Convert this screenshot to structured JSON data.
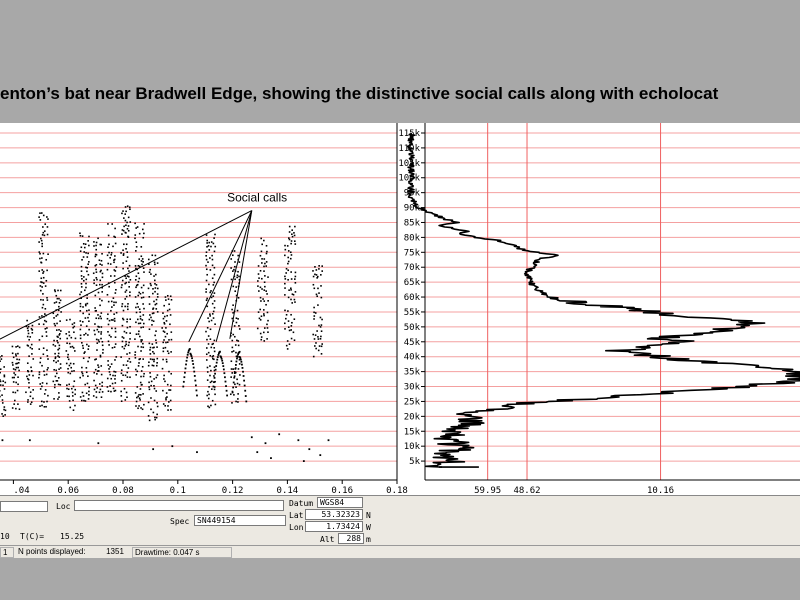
{
  "slide": {
    "title": "enton’s bat near Bradwell Edge, showing the distinctive social calls along with echolocat"
  },
  "annotation": {
    "label": "Social calls"
  },
  "info": {
    "loc_label": "Loc",
    "spec_label": "Spec",
    "spec_value": "SN449154",
    "temp_prefix": "10",
    "temp_label": "T(C)=",
    "temp_value": "15.25",
    "datum_label": "Datum",
    "datum_value": "WGS84",
    "lat_label": "Lat",
    "lat_value": "53.32323",
    "lat_dir": "N",
    "lon_label": "Lon",
    "lon_value": "1.73424",
    "lon_dir": "W",
    "alt_label": "Alt",
    "alt_value": "288",
    "alt_unit": "m"
  },
  "status": {
    "cell1": "1",
    "npoints_label": "N points displayed:",
    "npoints_value": "1351",
    "drawtime": "Drawtime: 0.047 s"
  },
  "chart_data": [
    {
      "type": "scatter",
      "title": "",
      "xlabel": "",
      "ylabel": "",
      "xlim": [
        0.03,
        0.18
      ],
      "ylim": [
        0,
        115
      ],
      "x_tick_labels": [
        ".04",
        "0.06",
        "0.08",
        "0.1",
        "0.12",
        "0.14",
        "0.16",
        "0.18"
      ],
      "x_ticks": [
        0.04,
        0.06,
        0.08,
        0.1,
        0.12,
        0.14,
        0.16,
        0.18
      ],
      "grid": true,
      "call_groups": [
        {
          "t": 0.031,
          "w": 0.002,
          "low": 22,
          "high": 48
        },
        {
          "t": 0.036,
          "w": 0.002,
          "low": 20,
          "high": 40
        },
        {
          "t": 0.041,
          "w": 0.002,
          "low": 22,
          "high": 44
        },
        {
          "t": 0.046,
          "w": 0.002,
          "low": 24,
          "high": 52
        },
        {
          "t": 0.051,
          "w": 0.0025,
          "low": 23,
          "high": 88
        },
        {
          "t": 0.056,
          "w": 0.002,
          "low": 25,
          "high": 62
        },
        {
          "t": 0.061,
          "w": 0.0025,
          "low": 22,
          "high": 52
        },
        {
          "t": 0.066,
          "w": 0.0025,
          "low": 25,
          "high": 82
        },
        {
          "t": 0.071,
          "w": 0.0025,
          "low": 26,
          "high": 80
        },
        {
          "t": 0.076,
          "w": 0.0025,
          "low": 28,
          "high": 85
        },
        {
          "t": 0.081,
          "w": 0.0025,
          "low": 25,
          "high": 90
        },
        {
          "t": 0.086,
          "w": 0.0025,
          "low": 22,
          "high": 85
        },
        {
          "t": 0.091,
          "w": 0.0025,
          "low": 18,
          "high": 75
        },
        {
          "t": 0.096,
          "w": 0.0025,
          "low": 22,
          "high": 60
        },
        {
          "t": 0.112,
          "w": 0.0025,
          "low": 23,
          "high": 82
        },
        {
          "t": 0.121,
          "w": 0.0025,
          "low": 24,
          "high": 75
        },
        {
          "t": 0.131,
          "w": 0.003,
          "low": 45,
          "high": 80
        },
        {
          "t": 0.141,
          "w": 0.003,
          "low": 42,
          "high": 84
        },
        {
          "t": 0.151,
          "w": 0.0025,
          "low": 40,
          "high": 70
        }
      ],
      "social_calls": [
        {
          "t": 0.104,
          "low": 30,
          "high": 44
        },
        {
          "t": 0.115,
          "low": 30,
          "high": 43
        },
        {
          "t": 0.122,
          "low": 28,
          "high": 43
        }
      ],
      "low_scatter": [
        {
          "t": 0.046,
          "f": 12
        },
        {
          "t": 0.071,
          "f": 11
        },
        {
          "t": 0.091,
          "f": 9
        },
        {
          "t": 0.098,
          "f": 10
        },
        {
          "t": 0.107,
          "f": 8
        },
        {
          "t": 0.127,
          "f": 13
        },
        {
          "t": 0.129,
          "f": 8
        },
        {
          "t": 0.132,
          "f": 11
        },
        {
          "t": 0.134,
          "f": 6
        },
        {
          "t": 0.137,
          "f": 14
        },
        {
          "t": 0.144,
          "f": 12
        },
        {
          "t": 0.146,
          "f": 5
        },
        {
          "t": 0.148,
          "f": 9
        },
        {
          "t": 0.152,
          "f": 7
        },
        {
          "t": 0.155,
          "f": 12
        },
        {
          "t": 0.031,
          "f": 7
        },
        {
          "t": 0.036,
          "f": 12
        }
      ]
    },
    {
      "type": "line",
      "title": "",
      "xlabel": "",
      "ylabel": "",
      "ylim": [
        0,
        115
      ],
      "y_tick_labels": [
        "5k",
        "10k",
        "15k",
        "20k",
        "25k",
        "30k",
        "35k",
        "40k",
        "45k",
        "50k",
        "55k",
        "60k",
        "65k",
        "70k",
        "75k",
        "80k",
        "85k",
        "90k",
        "95k",
        "100k",
        "105k",
        "110k",
        "115k"
      ],
      "y_ticks": [
        5,
        10,
        15,
        20,
        25,
        30,
        35,
        40,
        45,
        50,
        55,
        60,
        65,
        70,
        75,
        80,
        85,
        90,
        95,
        100,
        105,
        110,
        115
      ],
      "x_tick_labels": [
        "59.95",
        "48.62",
        "10.16"
      ],
      "x_tick_values": [
        59.95,
        48.62,
        10.16
      ],
      "xlim": [
        78,
        -30
      ],
      "grid": true,
      "spectrum": [
        [
          3,
          74
        ],
        [
          5,
          70
        ],
        [
          7,
          72
        ],
        [
          9,
          68
        ],
        [
          11,
          70
        ],
        [
          13,
          72
        ],
        [
          15,
          70
        ],
        [
          17,
          66
        ],
        [
          19,
          66
        ],
        [
          21,
          64
        ],
        [
          22,
          60
        ],
        [
          24,
          52
        ],
        [
          25,
          42
        ],
        [
          26,
          30
        ],
        [
          27,
          20
        ],
        [
          28,
          8
        ],
        [
          29,
          -4
        ],
        [
          30,
          -14
        ],
        [
          31,
          -22
        ],
        [
          32,
          -28
        ],
        [
          33,
          -30
        ],
        [
          34,
          -30
        ],
        [
          35,
          -28
        ],
        [
          36,
          -24
        ],
        [
          37,
          -14
        ],
        [
          38,
          -4
        ],
        [
          39,
          4
        ],
        [
          40,
          10
        ],
        [
          41,
          18
        ],
        [
          42,
          22
        ],
        [
          43,
          14
        ],
        [
          44,
          8
        ],
        [
          45,
          4
        ],
        [
          46,
          10
        ],
        [
          47,
          6
        ],
        [
          48,
          0
        ],
        [
          49,
          -8
        ],
        [
          50,
          -12
        ],
        [
          51,
          -16
        ],
        [
          52,
          -12
        ],
        [
          53,
          -2
        ],
        [
          54,
          6
        ],
        [
          55,
          12
        ],
        [
          56,
          18
        ],
        [
          57,
          26
        ],
        [
          58,
          34
        ],
        [
          59,
          38
        ],
        [
          60,
          42
        ],
        [
          62,
          45
        ],
        [
          64,
          47
        ],
        [
          66,
          48
        ],
        [
          68,
          49
        ],
        [
          70,
          47
        ],
        [
          72,
          46
        ],
        [
          73,
          44
        ],
        [
          74,
          40
        ],
        [
          75,
          46
        ],
        [
          76,
          50
        ],
        [
          77,
          52
        ],
        [
          78,
          54
        ],
        [
          79,
          57
        ],
        [
          80,
          63
        ],
        [
          81,
          68
        ],
        [
          82,
          66
        ],
        [
          83,
          70
        ],
        [
          84,
          74
        ],
        [
          85,
          68
        ],
        [
          86,
          72
        ],
        [
          88,
          76
        ],
        [
          90,
          80
        ],
        [
          93,
          82
        ],
        [
          100,
          82
        ],
        [
          115,
          82
        ]
      ]
    }
  ]
}
